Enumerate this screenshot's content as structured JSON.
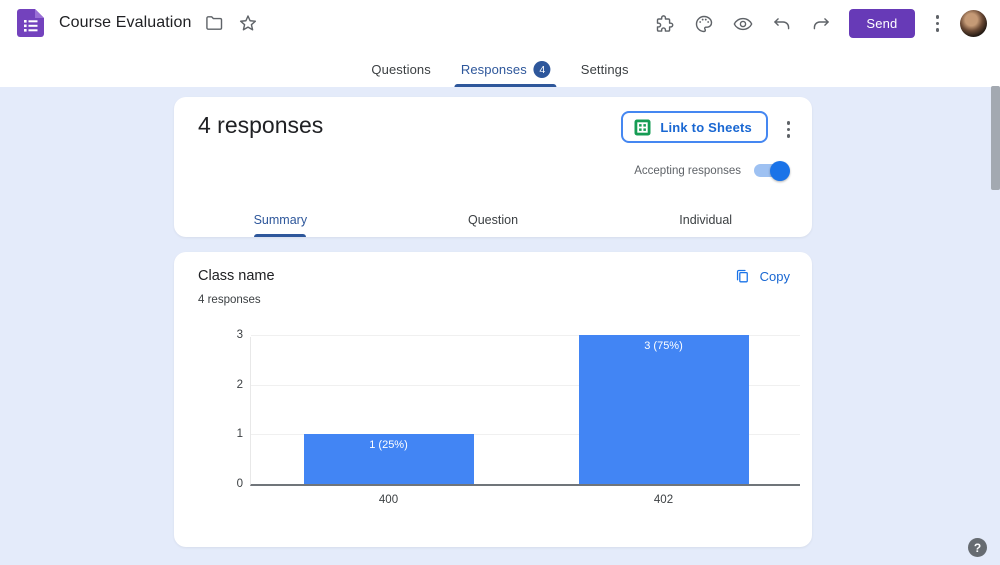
{
  "topbar": {
    "title": "Course Evaluation",
    "send_label": "Send",
    "icons": [
      "forms-logo",
      "move-to-folder",
      "star",
      "add-ons-puzzle",
      "customize-theme-palette",
      "preview-eye",
      "undo",
      "redo",
      "more-options",
      "account-avatar"
    ]
  },
  "nav_tabs": {
    "questions": "Questions",
    "responses": "Responses",
    "responses_badge": "4",
    "settings": "Settings"
  },
  "summary_card": {
    "title": "4 responses",
    "link_to_sheets_label": "Link to Sheets",
    "accepting_label": "Accepting responses",
    "toggle_state": "on",
    "tabs": {
      "summary": "Summary",
      "question": "Question",
      "individual": "Individual"
    }
  },
  "question_card": {
    "title": "Class name",
    "subtitle": "4 responses",
    "copy_label": "Copy"
  },
  "chart_data": {
    "type": "bar",
    "title": "Class name",
    "categories": [
      "400",
      "402"
    ],
    "values": [
      1,
      3
    ],
    "bar_labels": [
      "1 (25%)",
      "3 (75%)"
    ],
    "ylim": [
      0,
      3
    ],
    "yticks": [
      0,
      1,
      2,
      3
    ],
    "grid": true,
    "legend": false,
    "bar_color": "#4285f4"
  },
  "help": {
    "label": "?"
  },
  "colors": {
    "background": "#e4ebfa",
    "active_tab_blue": "#2e579b",
    "link_blue": "#1967d2",
    "toggle_blue": "#1a73e8",
    "bar_blue": "#4285f4",
    "send_purple": "#673ab7",
    "sheets_green": "#169c54",
    "icon_gray": "#5f6368"
  }
}
